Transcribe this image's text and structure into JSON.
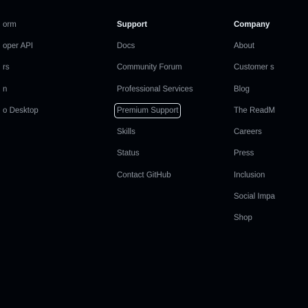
{
  "footer": {
    "col1": {
      "items": [
        {
          "label": "orm"
        },
        {
          "label": "oper API"
        },
        {
          "label": "rs"
        },
        {
          "label": "n"
        },
        {
          "label": "o Desktop"
        }
      ]
    },
    "col2": {
      "heading": "Support",
      "items": [
        {
          "label": "Docs"
        },
        {
          "label": "Community Forum"
        },
        {
          "label": "Professional Services"
        },
        {
          "label": "Premium Support"
        },
        {
          "label": "Skills"
        },
        {
          "label": "Status"
        },
        {
          "label": "Contact GitHub"
        }
      ]
    },
    "col3": {
      "heading": "Company",
      "items": [
        {
          "label": "About"
        },
        {
          "label": "Customer s"
        },
        {
          "label": "Blog"
        },
        {
          "label": "The ReadM"
        },
        {
          "label": "Careers"
        },
        {
          "label": "Press"
        },
        {
          "label": "Inclusion"
        },
        {
          "label": "Social Impa"
        },
        {
          "label": "Shop"
        }
      ]
    }
  }
}
